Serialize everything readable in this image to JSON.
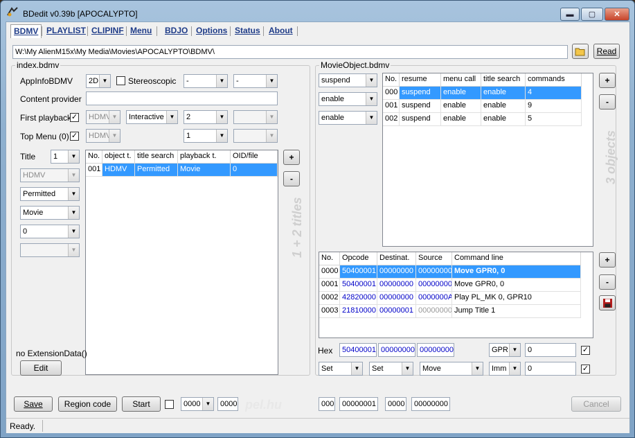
{
  "window": {
    "title": "BDedit v0.39b [APOCALYPTO]",
    "min": "▬",
    "max": "▢",
    "close": "✕"
  },
  "tabs": [
    {
      "label": "BDMV"
    },
    {
      "label": "PLAYLIST"
    },
    {
      "label": "CLIPINF"
    },
    {
      "label": "Menu"
    },
    {
      "label": "BDJO"
    },
    {
      "label": "Options"
    },
    {
      "label": "Status"
    },
    {
      "label": "About"
    }
  ],
  "path": {
    "value": "W:\\My AlienM15x\\My Media\\Movies\\APOCALYPTO\\BDMV\\",
    "read_label": "Read"
  },
  "index": {
    "group_title": "index.bdmv",
    "appinfo_label": "AppInfoBDMV",
    "appinfo_mode": "2D",
    "stereo_label": "Stereoscopic",
    "appinfo_c1": "-",
    "appinfo_c2": "-",
    "content_provider_label": "Content provider",
    "content_provider_value": "",
    "first_playback_label": "First playback",
    "fp_type": "HDMV",
    "fp_mode": "Interactive",
    "fp_num": "2",
    "fp_extra": "",
    "top_menu_label": "Top Menu (0)",
    "tm_type": "HDMV",
    "tm_num": "1",
    "tm_extra": "",
    "title_label": "Title",
    "title_num": "1",
    "left_combos": [
      "HDMV",
      "Permitted",
      "Movie",
      "0",
      ""
    ],
    "table_headers": [
      "No.",
      "object t.",
      "title search",
      "playback t.",
      "OID/file"
    ],
    "rows": [
      [
        "001",
        "HDMV",
        "Permitted",
        "Movie",
        "0"
      ]
    ],
    "add": "+",
    "remove": "-",
    "side_text": "1 + 2 titles",
    "ext_label": "no ExtensionData()",
    "edit_label": "Edit"
  },
  "movie": {
    "group_title": "MovieObject.bdmv",
    "combos": [
      "suspend",
      "enable",
      "enable"
    ],
    "obj_headers": [
      "No.",
      "resume",
      "menu call",
      "title search",
      "commands"
    ],
    "obj_rows": [
      [
        "000",
        "suspend",
        "enable",
        "enable",
        "4"
      ],
      [
        "001",
        "suspend",
        "enable",
        "enable",
        "9"
      ],
      [
        "002",
        "suspend",
        "enable",
        "enable",
        "5"
      ]
    ],
    "add": "+",
    "remove": "-",
    "side_text": "3 objects",
    "cmd_headers": [
      "No.",
      "Opcode",
      "Destinat.",
      "Source",
      "Command line"
    ],
    "cmd_rows": [
      [
        "0000",
        "50400001",
        "00000000",
        "00000000",
        "Move GPR0, 0"
      ],
      [
        "0001",
        "50400001",
        "00000000",
        "00000000",
        "Move GPR0, 0"
      ],
      [
        "0002",
        "42820000",
        "00000000",
        "0000000A",
        "Play PL_MK 0, GPR10"
      ],
      [
        "0003",
        "21810000",
        "00000001",
        "00000000",
        "Jump Title 1"
      ]
    ],
    "hex_label": "Hex",
    "hex1": "50400001",
    "hex2": "00000000",
    "hex3": "00000000",
    "gpr": "GPR",
    "gpr_val": "0",
    "imm": "Imm",
    "imm_val": "0",
    "set1": "Set",
    "set2": "Set",
    "op": "Move"
  },
  "bottom": {
    "save": "Save",
    "region": "Region code",
    "start": "Start",
    "combo_val": "0000",
    "field1": "0000",
    "f2": "000",
    "f3": "00000001",
    "f4": "0000",
    "f5": "00000000",
    "cancel": "Cancel",
    "watermark": "pel.hu"
  },
  "status": {
    "text": "Ready."
  }
}
